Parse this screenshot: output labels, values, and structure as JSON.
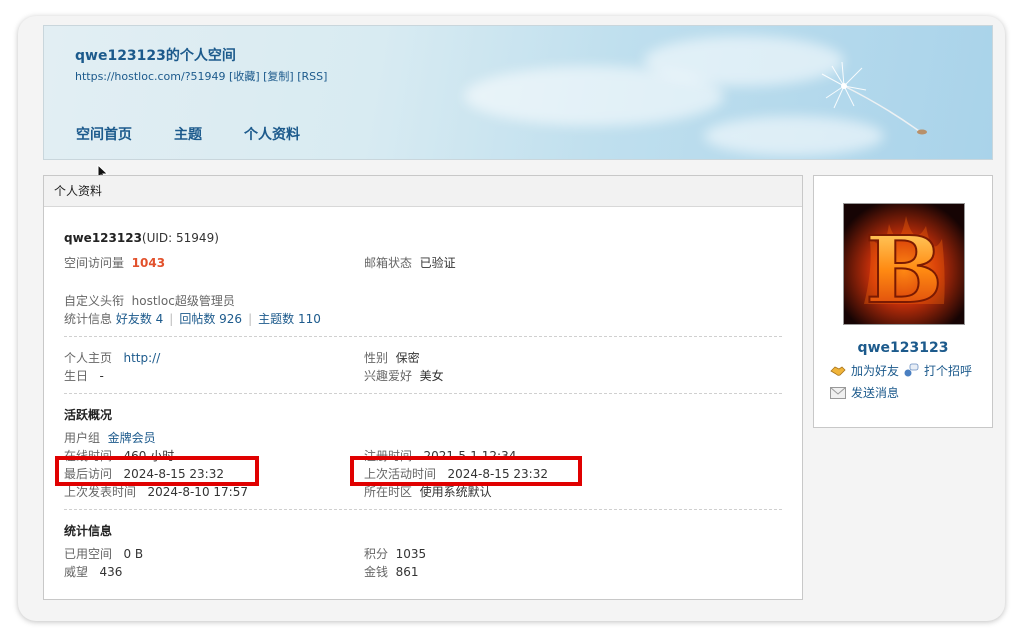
{
  "header": {
    "title": "qwe123123的个人空间",
    "url": "https://hostloc.com/?51949",
    "link_favorite": "[收藏]",
    "link_copy": "[复制]",
    "link_rss": "[RSS]",
    "nav": [
      "空间首页",
      "主题",
      "个人资料"
    ]
  },
  "profile": {
    "section_title": "个人资料",
    "username": "qwe123123",
    "uid": "(UID: 51949)",
    "visits_label": "空间访问量",
    "visits_value": "1043",
    "email_label": "邮箱状态",
    "email_value": "已验证",
    "custom_title_label": "自定义头衔",
    "custom_title_value": "hostloc超级管理员",
    "stats_label": "统计信息",
    "friends": "好友数 4",
    "replies": "回帖数 926",
    "threads": "主题数 110",
    "homepage_label": "个人主页",
    "homepage_value": "http://",
    "gender_label": "性别",
    "gender_value": "保密",
    "birthday_label": "生日",
    "birthday_value": "-",
    "hobby_label": "兴趣爱好",
    "hobby_value": "美女"
  },
  "activity": {
    "heading": "活跃概况",
    "group_label": "用户组",
    "group_value": "金牌会员",
    "online_label": "在线时间",
    "online_value": "460 小时",
    "register_label": "注册时间",
    "register_value": "2021-5-1 12:34",
    "last_visit_label": "最后访问",
    "last_visit_value": "2024-8-15 23:32",
    "last_active_label": "上次活动时间",
    "last_active_value": "2024-8-15 23:32",
    "last_post_label": "上次发表时间",
    "last_post_value": "2024-8-10 17:57",
    "timezone_label": "所在时区",
    "timezone_value": "使用系统默认"
  },
  "stats": {
    "heading": "统计信息",
    "space_label": "已用空间",
    "space_value": "0 B",
    "points_label": "积分",
    "points_value": "1035",
    "prestige_label": "威望",
    "prestige_value": "436",
    "money_label": "金钱",
    "money_value": "861"
  },
  "sidebar": {
    "avatar_letter": "B",
    "username": "qwe123123",
    "add_friend": "加为好友",
    "greet": "打个招呼",
    "message": "发送消息"
  },
  "colors": {
    "link": "#1c5a8c",
    "highlight": "#e00000",
    "visits": "#e2512c"
  }
}
